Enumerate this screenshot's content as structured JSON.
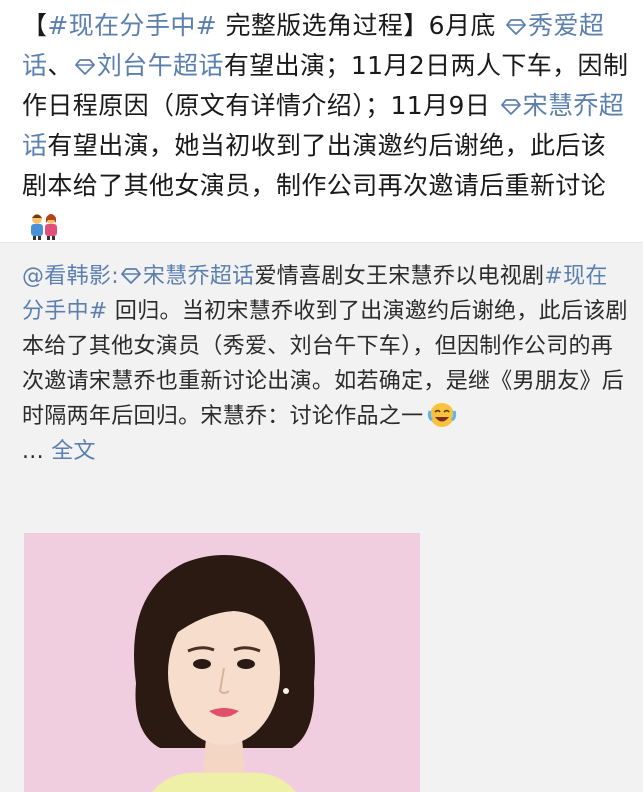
{
  "post": {
    "segments": [
      {
        "text": "【",
        "link": false
      },
      {
        "text": "#现在分手中#",
        "link": true
      },
      {
        "text": " 完整版选角过程】6月底 ",
        "link": false
      },
      {
        "text": "",
        "link": true,
        "icon": "gem-icon"
      },
      {
        "text": "秀爱超话",
        "link": true
      },
      {
        "text": "、",
        "link": false
      },
      {
        "text": "",
        "link": true,
        "icon": "gem-icon"
      },
      {
        "text": "刘台午超话",
        "link": true
      },
      {
        "text": "有望出演；11月2日两人下车，因制作日程原因（原文有详情介绍）；11月9日 ",
        "link": false
      },
      {
        "text": "",
        "link": true,
        "icon": "gem-icon"
      },
      {
        "text": "宋慧乔超话",
        "link": true
      },
      {
        "text": "有望出演，她当初收到了出演邀约后谢绝，此后该剧本给了其他女演员，制作公司再次邀请后重新讨论",
        "link": false
      }
    ],
    "trailing_emoji": "people-emoji-icon"
  },
  "repost": {
    "author": "@看韩影",
    "colon": ":",
    "tag_supertopic": "宋慧乔超话",
    "text_1": "爱情喜剧女王宋慧乔以电视剧",
    "hashtag": "#现在分手中#",
    "text_2": " 回归。当初宋慧乔收到了出演邀约后谢绝，此后该剧本给了其他女演员（秀爱、刘台午下车），但因制作公司的再次邀请宋慧乔也重新讨论出演。如若确定，是继《男朋友》后时隔两年后回归。宋慧乔：讨论作品之一",
    "trailing_emoji": "laughing-crying-emoji-icon",
    "ellipsis": "... ",
    "full_text_link": "全文"
  },
  "photo": {
    "icon": "portrait-photo",
    "background_color": "#f1cde0"
  },
  "colors": {
    "link": "#5b7faf",
    "text": "#1a1a1a",
    "repost_bg": "#f2f2f2"
  }
}
